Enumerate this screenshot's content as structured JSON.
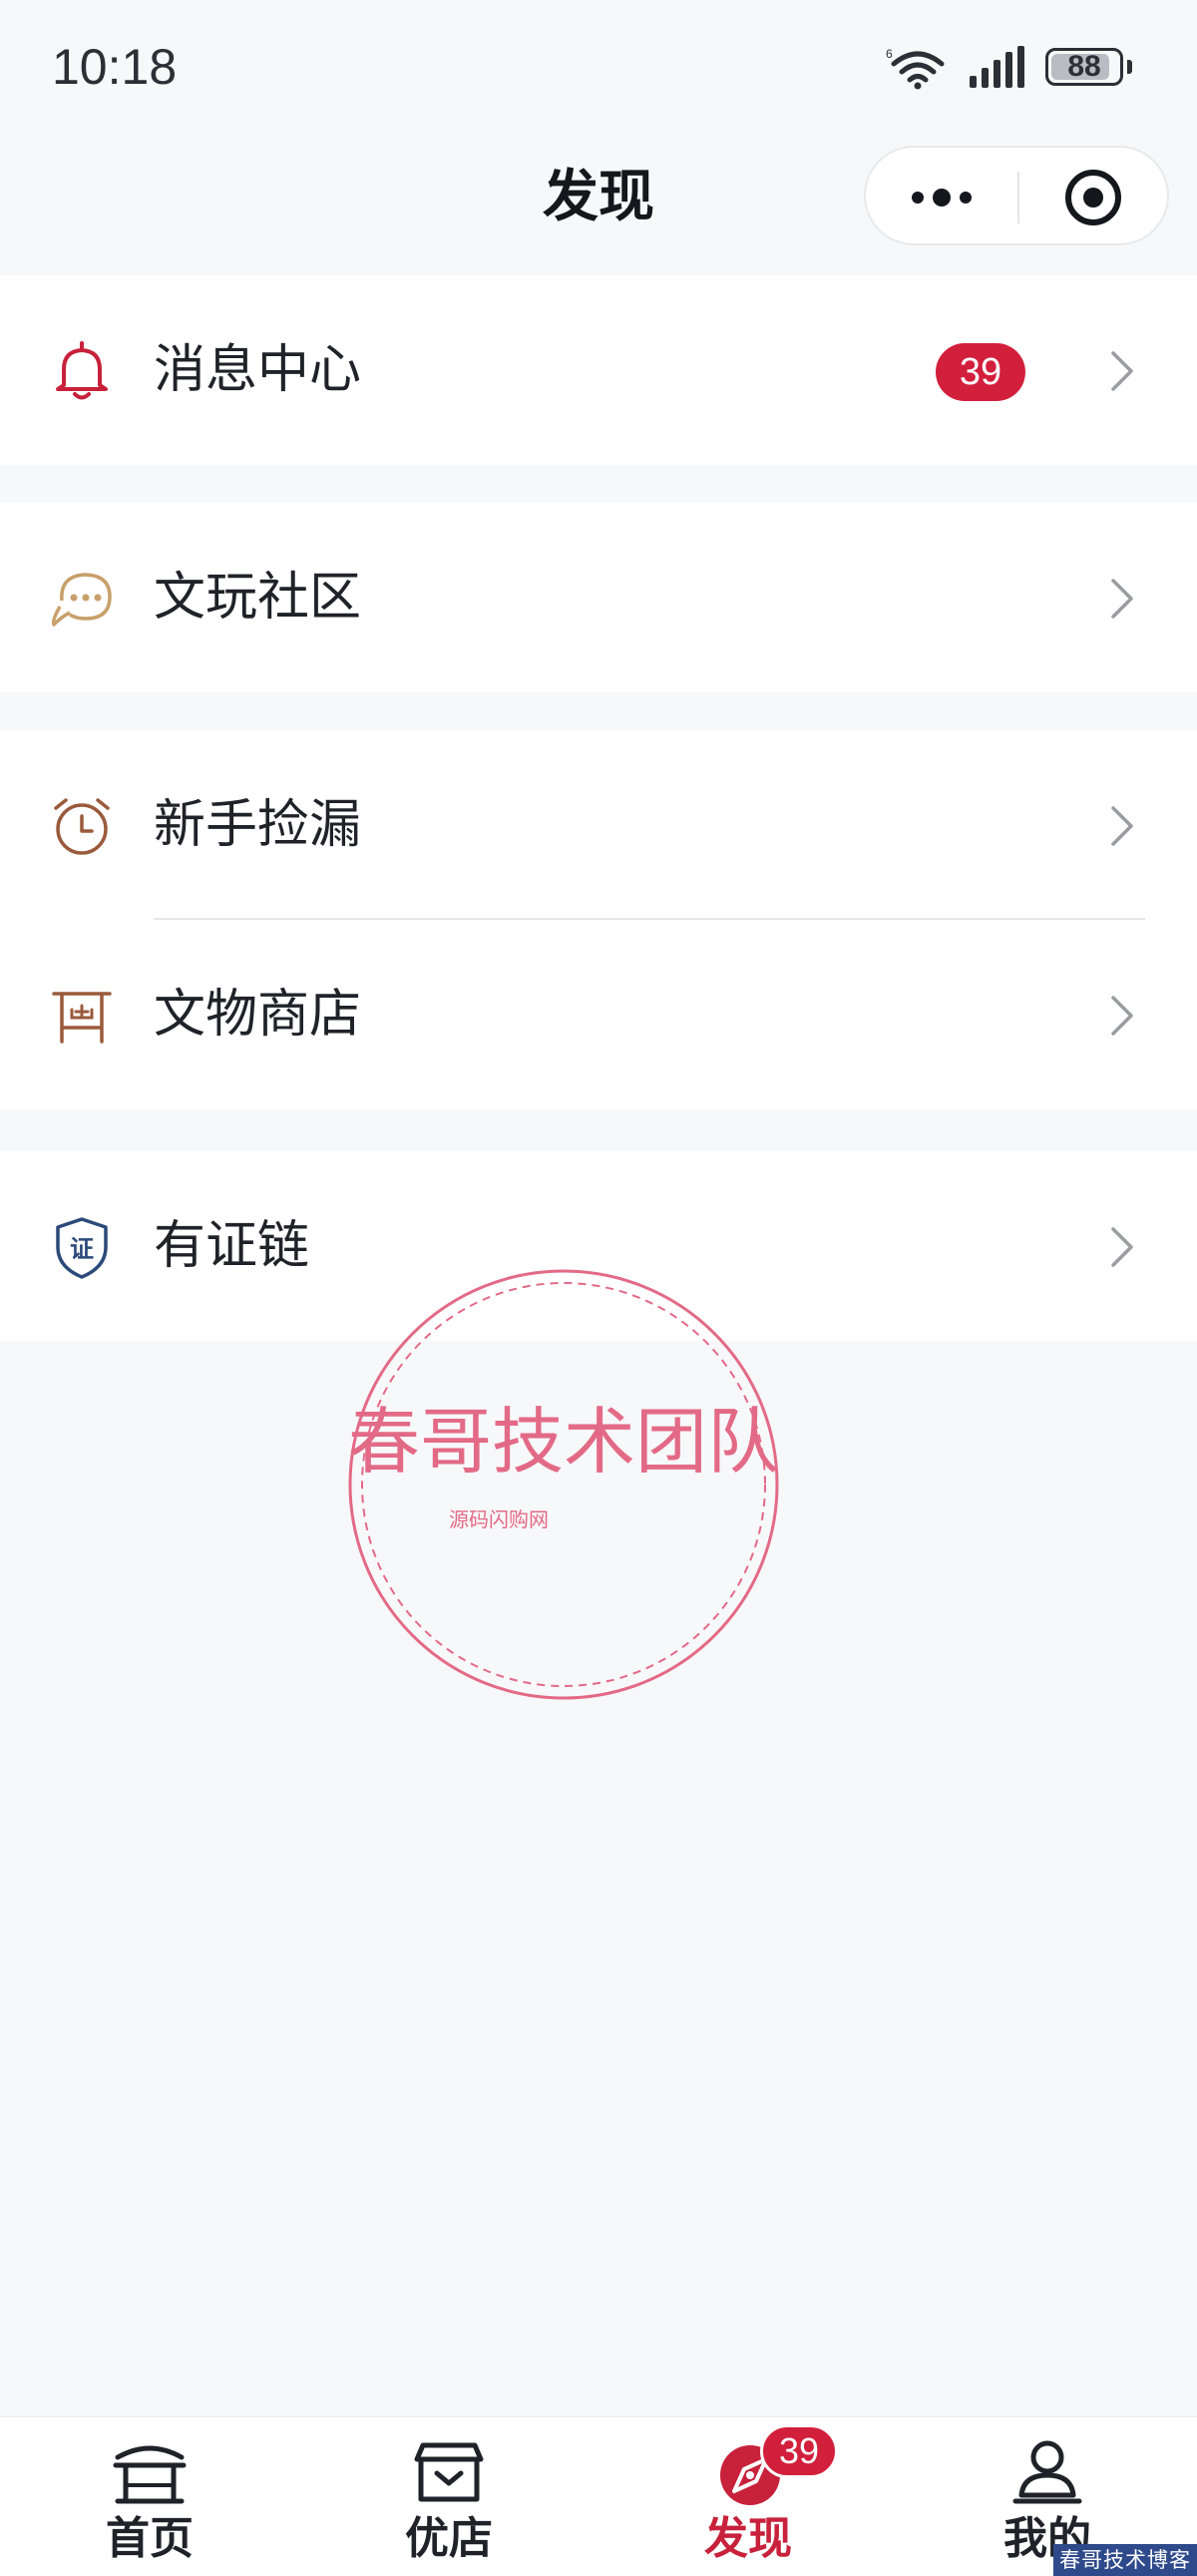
{
  "status_bar": {
    "time": "10:18",
    "battery": "88",
    "battery_level": 0.88
  },
  "nav": {
    "title": "发现"
  },
  "menu": {
    "message_center": {
      "label": "消息中心",
      "badge": "39"
    },
    "community": {
      "label": "文玩社区"
    },
    "newbie": {
      "label": "新手捡漏"
    },
    "relic_shop": {
      "label": "文物商店"
    },
    "cert_chain": {
      "label": "有证链"
    }
  },
  "stamp": {
    "title": "春哥技术团队",
    "subtitle": "源码闪购网"
  },
  "tabbar": {
    "home": "首页",
    "shop": "优店",
    "discover": "发现",
    "discover_badge": "39",
    "mine": "我的"
  },
  "watermark": "春哥技术博客",
  "colors": {
    "accent": "#c8213b",
    "badge": "#d21f3c",
    "icon_brown": "#9a5a3c",
    "icon_gold": "#c8a06a",
    "icon_navy": "#2b4a7a"
  }
}
